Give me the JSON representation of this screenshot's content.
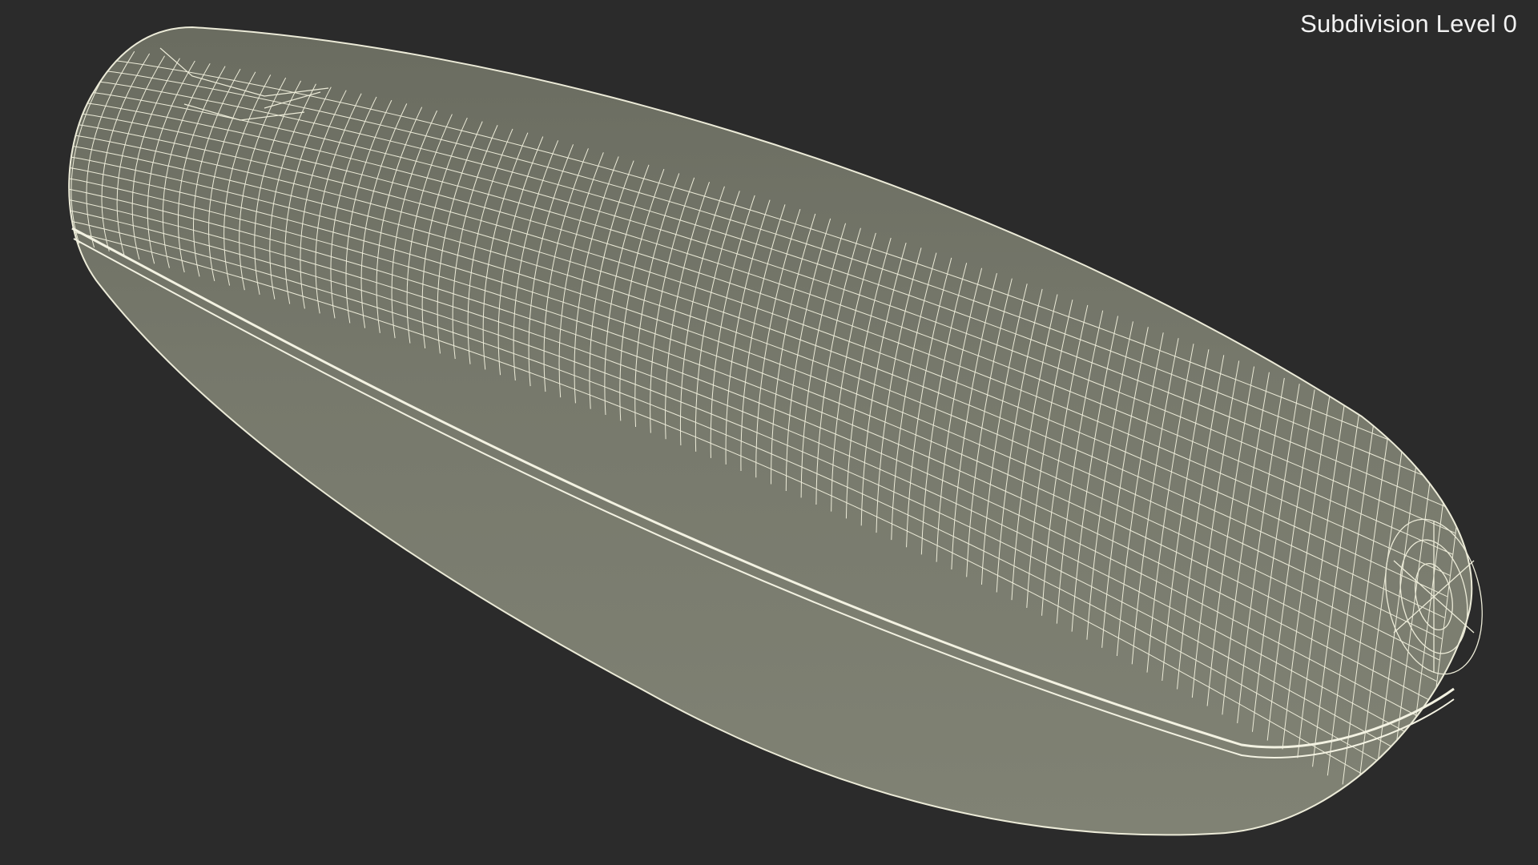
{
  "viewport": {
    "subdivision_label": "Subdivision Level 0",
    "background_color": "#2b2b2b"
  },
  "model": {
    "icon": "wireframe-mesh",
    "shade_color": "#7d7f72",
    "wire_color": "#ecebd8"
  }
}
